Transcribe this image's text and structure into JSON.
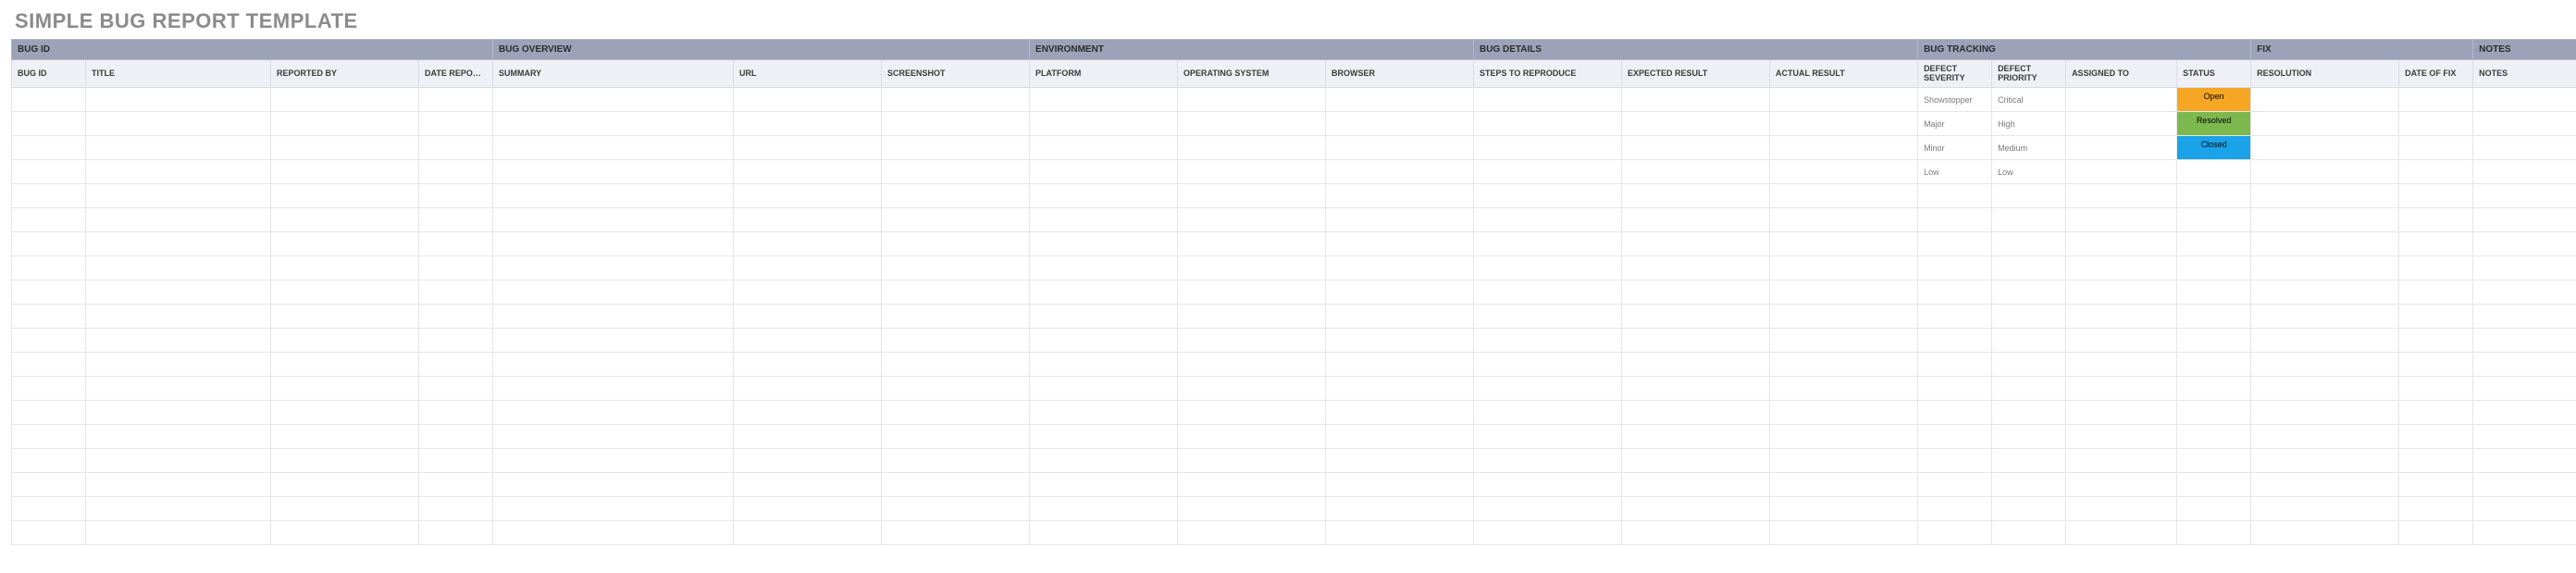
{
  "title": "SIMPLE BUG REPORT TEMPLATE",
  "groups": [
    {
      "label": "BUG ID",
      "span": 4
    },
    {
      "label": "BUG OVERVIEW",
      "span": 3
    },
    {
      "label": "ENVIRONMENT",
      "span": 3
    },
    {
      "label": "BUG DETAILS",
      "span": 3
    },
    {
      "label": "BUG TRACKING",
      "span": 4
    },
    {
      "label": "FIX",
      "span": 2
    },
    {
      "label": "NOTES",
      "span": 1
    }
  ],
  "columns": [
    "BUG ID",
    "TITLE",
    "REPORTED BY",
    "DATE REPORTED",
    "SUMMARY",
    "URL",
    "SCREENSHOT",
    "PLATFORM",
    "OPERATING SYSTEM",
    "BROWSER",
    "STEPS TO REPRODUCE",
    "EXPECTED RESULT",
    "ACTUAL RESULT",
    "DEFECT SEVERITY",
    "DEFECT PRIORITY",
    "ASSIGNED TO",
    "STATUS",
    "RESOLUTION",
    "DATE OF FIX",
    "NOTES"
  ],
  "severity_options": [
    "Showstopper",
    "Major",
    "Minor",
    "Low"
  ],
  "priority_options": [
    "Critical",
    "High",
    "Medium",
    "Low"
  ],
  "status_options": [
    {
      "label": "Open",
      "class": "status-open"
    },
    {
      "label": "Resolved",
      "class": "status-resolved"
    },
    {
      "label": "Closed",
      "class": "status-closed"
    }
  ],
  "empty_rows": 19,
  "colors": {
    "group_header_bg": "#9ca3b8",
    "col_header_bg": "#eef0f5",
    "status_open": "#f5a623",
    "status_resolved": "#7db84e",
    "status_closed": "#1aa3e8"
  }
}
